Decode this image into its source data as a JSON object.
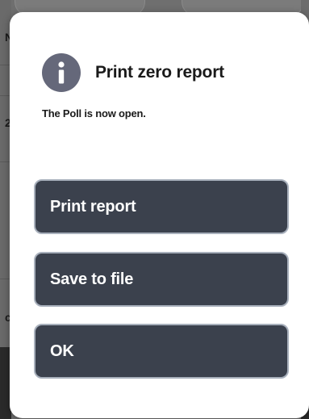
{
  "background": {
    "fragments": [
      "N",
      "2",
      "c"
    ]
  },
  "dialog": {
    "icon": "info-icon",
    "title": "Print zero report",
    "message": "The Poll is now open.",
    "buttons": {
      "print_report": "Print report",
      "save_to_file": "Save to file",
      "ok": "OK"
    }
  },
  "colors": {
    "button_bg": "#3b414d",
    "button_border": "#a8b0bc",
    "icon_bg": "#65687a",
    "dialog_bg": "#ffffff"
  }
}
